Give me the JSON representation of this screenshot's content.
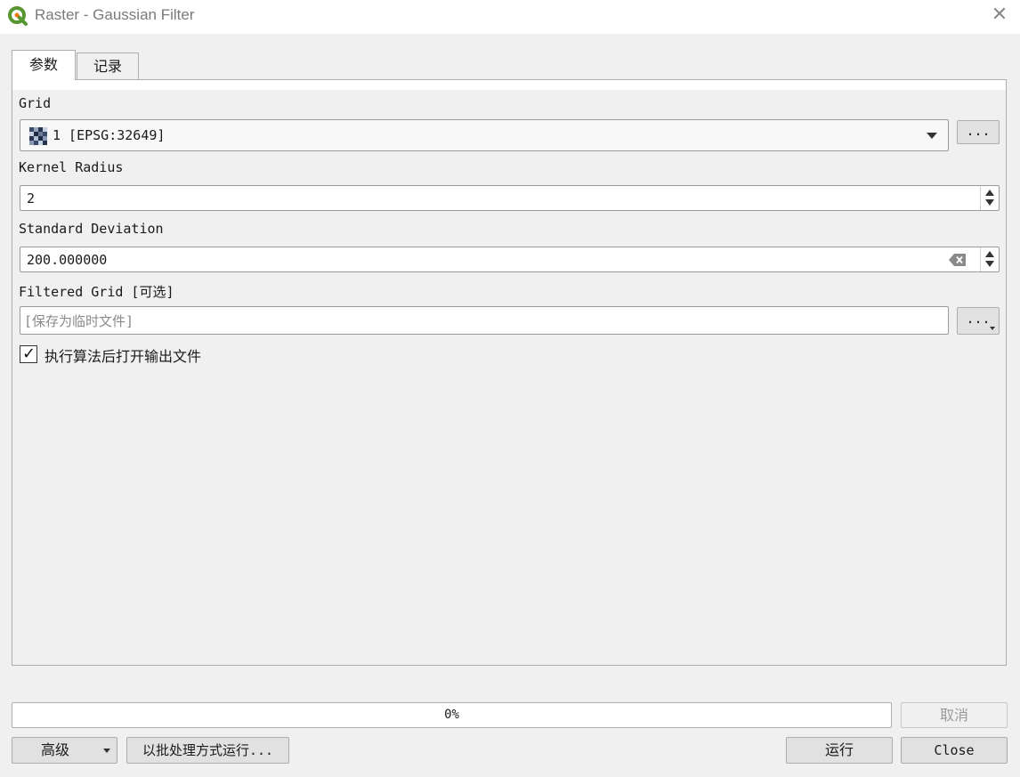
{
  "window": {
    "title": "Raster - Gaussian Filter",
    "close_glyph": "✕"
  },
  "tabs": [
    {
      "label": "参数",
      "active": true
    },
    {
      "label": "记录",
      "active": false
    }
  ],
  "params": {
    "grid": {
      "label": "Grid",
      "value": "1 [EPSG:32649]",
      "browse_label": "..."
    },
    "kernel_radius": {
      "label": "Kernel Radius",
      "value": "2"
    },
    "std_dev": {
      "label": "Standard Deviation",
      "value": "200.000000"
    },
    "filtered_grid": {
      "label": "Filtered Grid [可选]",
      "placeholder": "[保存为临时文件]",
      "browse_label": "..."
    },
    "open_output": {
      "label": "执行算法后打开输出文件",
      "checked": true,
      "check_glyph": "✓"
    }
  },
  "footer": {
    "progress_text": "0%",
    "progress_value": 0,
    "cancel_label": "取消",
    "advanced_label": "高级",
    "batch_label": "以批处理方式运行...",
    "run_label": "运行",
    "close_label": "Close"
  },
  "colors": {
    "qgis_green": "#589632",
    "qgis_yellow": "#ee7913"
  }
}
